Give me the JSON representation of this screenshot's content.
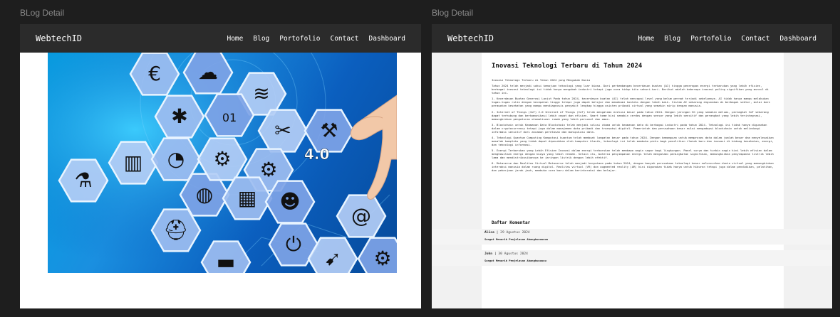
{
  "frames": [
    {
      "label": "BLog Detail",
      "brand": "WebtechID",
      "nav": [
        "Home",
        "Blog",
        "Portofolio",
        "Contact",
        "Dashboard"
      ],
      "hero_badge": "4.0",
      "hero_icons": [
        "euro-icon",
        "cloud-icon",
        "wifi-icon",
        "lightbulb-icon",
        "binary-icon",
        "tools-icon",
        "gears-icon",
        "workers-icon",
        "factory-icon",
        "pie-chart-icon",
        "world-map-icon",
        "gear-icon",
        "chip-icon",
        "head-gear-icon",
        "flask-icon",
        "engineer-icon",
        "plug-icon",
        "at-icon",
        "truck-icon",
        "robot-arm-icon",
        "runner-icon"
      ]
    },
    {
      "label": "Blog Detail",
      "brand": "WebtechID",
      "nav": [
        "Home",
        "Blog",
        "Portofolio",
        "Contact",
        "Dashboard"
      ],
      "article": {
        "title": "Inovasi Teknologi Terbaru di Tahun 2024",
        "paragraphs": [
          "Inovasi Teknologi Terbaru di Tahun 2024 yang Mengubah Dunia",
          "Tahun 2024 telah menjadi saksi kemajuan teknologi yang luar biasa. Dari perkembangan kecerdasan buatan (AI) hingga penerapan energi terbarukan yang lebih efisien, berbagai inovasi teknologi ini tidak hanya mengubah industri tetapi juga cara hidup kita sehari-hari. Berikut adalah beberapa inovasi paling signifikan yang muncul di tahun ini.",
          "1. Kecerdasan Buatan Generasi Lanjut Pada tahun 2024, kecerdasan buatan (AI) telah mencapai level yang belum pernah terjadi sebelumnya. AI tidak hanya mampu melakukan tugas-tugas rutin dengan kecepatan tinggi tetapi juga dapat belajar dan memahami konteks dengan lebih baik. Sistem AI sekarang digunakan di berbagai sektor, mulai dari perawatan kesehatan yang mampu mendiagnosis penyakit lengkap hingga asisten pribadi virtual yang semakin mirip dengan manusia.",
          "2. Internet of Things (IoT) 2.0 Internet of Things (IoT) telah mengalami evolusi besar pada tahun 2024. Dengan jaringan 5G yang semakin meluas, perangkat IoT sekarang dapat terhubung dan berkomunikasi lebih cepat dan efisien. Smart home kini semakin cerdas dengan sensor yang lebih sensitif dan perangkat yang lebih terintegrasi, memungkinkan pengaturan otomatisasi rumah yang lebih personal dan aman.",
          "3. Blockchain untuk Keamanan Data Blockchain telah menjadi solusi utama untuk keamanan data di berbagai industri pada tahun 2024. Teknologi ini tidak hanya digunakan dalam cryptocurrency tetapi juga dalam manajemen data pribadi dan transaksi digital. Pemerintah dan perusahaan besar mulai mengadopsi blockchain untuk melindungi informasi sensitif dari ancaman peretasan dan manipulasi data.",
          "4. Teknologi Quantum Computing Komputasi kuantum telah membuat lompatan besar pada tahun 2024. Dengan kemampuan untuk memproses data dalam jumlah besar dan menyelesaikan masalah kompleks yang tidak dapat dipecahkan oleh komputer klasik, teknologi ini telah membuka pintu bagi penelitian ilmiah baru dan inovasi di bidang kesehatan, energi, dan teknologi informasi.",
          "5. Energi Terbarukan yang Lebih Efisien Inovasi dalam energi terbarukan telah membawa angin segar bagi lingkungan. Panel surya dan turbin angin kini lebih efisien dalam menghasilkan energi dengan biaya yang lebih rendah. Selain itu, baterai penyimpanan energi telah mengalami peningkatan signifikan, memungkinkan penyimpanan listrik lebih lama dan mendistribusikannya ke jaringan listrik dengan lebih efektif.",
          "6. Metaverse dan Realitas Virtual Metaverse telah menjadi kenyataan pada tahun 2024, dengan banyak perusahaan teknologi besar meluncurkan dunia virtual yang memungkinkan interaksi manusia dalam ruang digital. Realitas virtual (VR) dan augmented reality (AR) kini digunakan tidak hanya untuk hiburan tetapi juga dalam pendidikan, pelatihan, dan pekerjaan jarak jauh, membuka cara baru dalam berinteraksi dan belajar."
        ]
      },
      "comments_title": "Daftar Komentar",
      "comments": [
        {
          "author": "Alice",
          "date": "29 Agustus 2024",
          "text": "Sangat Menarik Penjelasan Abangkuuuuuuu"
        },
        {
          "author": "John",
          "date": "30 Agustus 2024",
          "text": "Sangat Menarik Penjelasan Abangkuuuuuu"
        }
      ]
    }
  ],
  "colors": {
    "canvas": "#1e1e1e",
    "navbar": "#2b2b2b",
    "hero_blue": "#0b5fbf",
    "hex_fill": "#8fb0e8"
  }
}
